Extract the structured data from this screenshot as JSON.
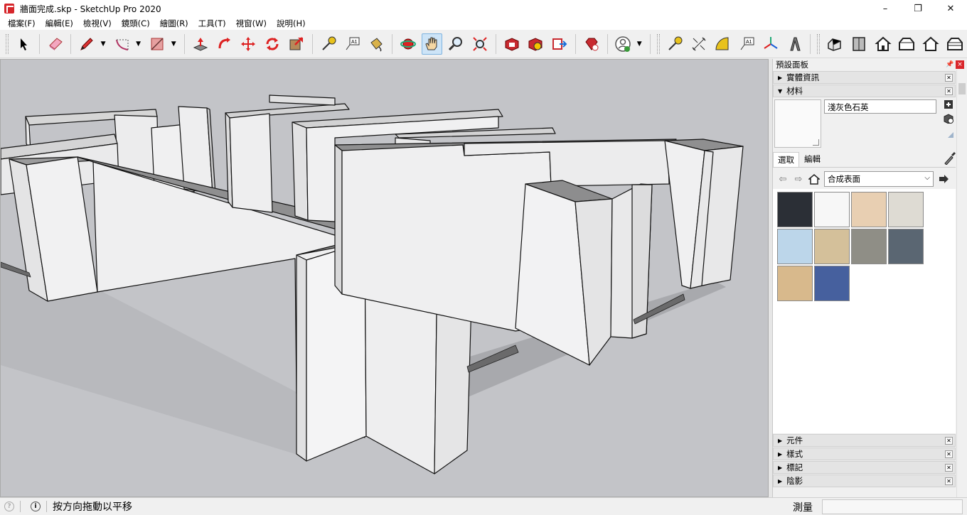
{
  "window": {
    "title": "牆面完成.skp - SketchUp Pro 2020",
    "controls": {
      "minimize": "–",
      "restore": "❐",
      "close": "✕"
    }
  },
  "menu": [
    "檔案(F)",
    "編輯(E)",
    "檢視(V)",
    "鏡頭(C)",
    "繪圖(R)",
    "工具(T)",
    "視窗(W)",
    "說明(H)"
  ],
  "toolbar": {
    "active_tool": "pan-tool",
    "tools": [
      "select",
      "eraser",
      "pencil",
      "arc",
      "rectangle",
      "push-pull",
      "follow-me",
      "move",
      "rotate",
      "scale",
      "tape-measure",
      "text",
      "paint-bucket",
      "orbit",
      "pan",
      "zoom",
      "zoom-extents",
      "3d-warehouse",
      "extension-warehouse",
      "send-to-layout",
      "extension-manager",
      "account",
      "dimension",
      "protractor",
      "axes",
      "3d-text",
      "iso-view",
      "top-view",
      "front-view",
      "right-view",
      "back-view",
      "left-view"
    ]
  },
  "panel": {
    "title": "預設面板",
    "pin": "📌",
    "close": "×",
    "trays": {
      "entity_info": "實體資訊",
      "materials": "材料",
      "components": "元件",
      "styles": "樣式",
      "tags": "標記",
      "shadows": "陰影"
    },
    "material_name": "淺灰色石英",
    "tabs": {
      "select": "選取",
      "edit": "編輯"
    },
    "collection": "合成表面",
    "swatches": [
      "#2b2f36",
      "#f7f7f7",
      "#e8cfb2",
      "#dedbd3",
      "#bcd6ea",
      "#d4c09a",
      "#8f8e86",
      "#5a6672",
      "#d8b98c",
      "#46609e"
    ]
  },
  "status": {
    "hint": "按方向拖動以平移",
    "measure_label": "測量",
    "measure_value": ""
  }
}
